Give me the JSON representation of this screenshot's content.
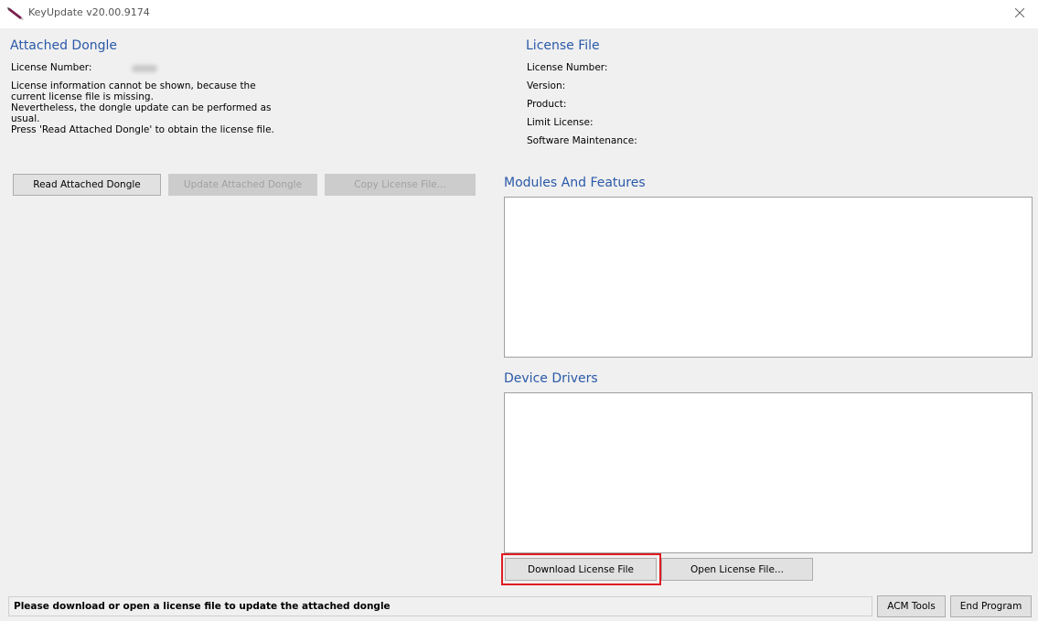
{
  "window": {
    "title": "KeyUpdate v20.00.9174",
    "close_glyph": "✕",
    "app_icon": "pen-icon"
  },
  "attached_dongle": {
    "heading": "Attached Dongle",
    "license_number_label": "License Number:",
    "info_lines": [
      "License information cannot be shown, because the",
      "current license file is missing.",
      "Nevertheless, the dongle update can be performed as",
      "usual.",
      "Press 'Read Attached Dongle' to obtain the license file."
    ],
    "buttons": {
      "read": "Read Attached Dongle",
      "update": "Update Attached Dongle",
      "copy": "Copy License File..."
    }
  },
  "license_file": {
    "heading": "License File",
    "labels": {
      "license_number": "License Number:",
      "version": "Version:",
      "product": "Product:",
      "limit_license": "Limit License:",
      "software_maintenance": "Software Maintenance:"
    }
  },
  "modules": {
    "heading": "Modules And Features"
  },
  "drivers": {
    "heading": "Device Drivers"
  },
  "actions": {
    "download": "Download License File",
    "open": "Open License File..."
  },
  "status": {
    "message": "Please download or open a license file to update the attached dongle"
  },
  "footer": {
    "acm_tools": "ACM Tools",
    "end_program": "End Program"
  },
  "colors": {
    "heading_blue": "#2a59a8",
    "highlight_red": "#e01b24",
    "window_bg": "#f0f0f0"
  }
}
